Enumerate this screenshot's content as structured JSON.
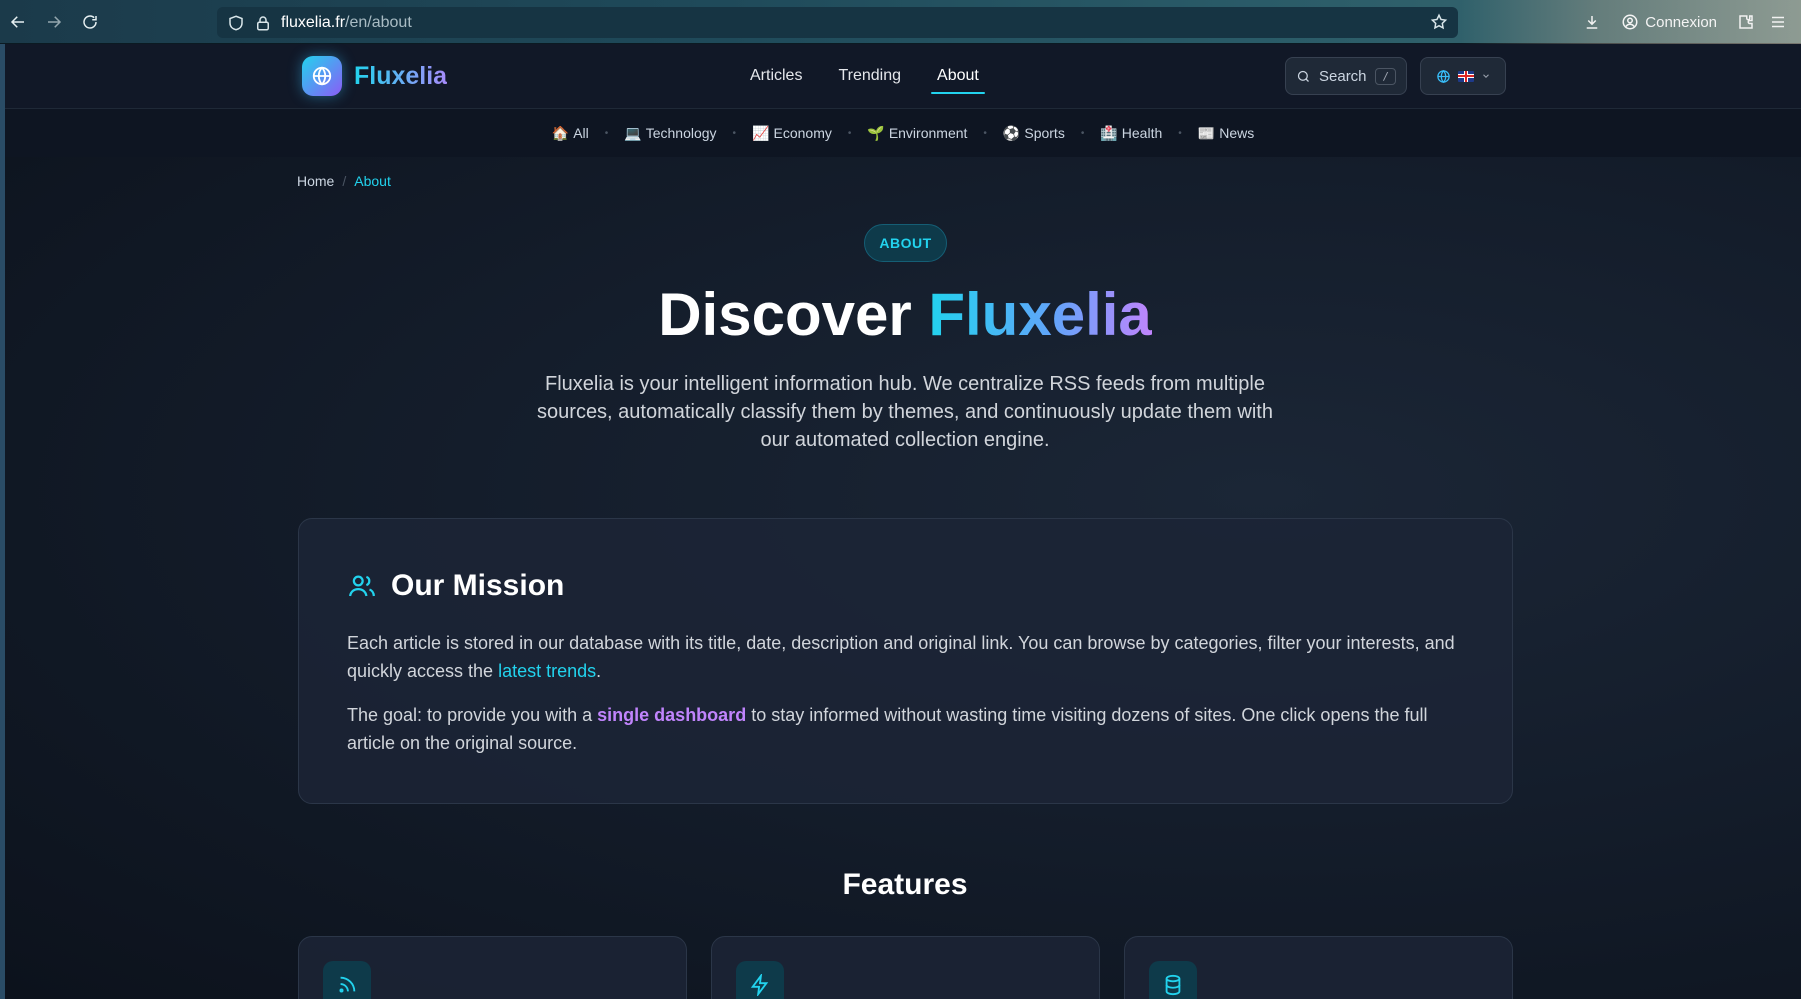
{
  "browser": {
    "url_host": "fluxelia.fr",
    "url_path": "/en/about",
    "account_label": "Connexion"
  },
  "header": {
    "brand": "Fluxelia",
    "nav": [
      "Articles",
      "Trending",
      "About"
    ],
    "active_nav": "About",
    "search_label": "Search",
    "search_shortcut": "/"
  },
  "categories": [
    {
      "emoji": "🏠",
      "label": "All"
    },
    {
      "emoji": "💻",
      "label": "Technology"
    },
    {
      "emoji": "📈",
      "label": "Economy"
    },
    {
      "emoji": "🌱",
      "label": "Environment"
    },
    {
      "emoji": "⚽",
      "label": "Sports"
    },
    {
      "emoji": "🏥",
      "label": "Health"
    },
    {
      "emoji": "📰",
      "label": "News"
    }
  ],
  "breadcrumb": {
    "home": "Home",
    "sep": "/",
    "current": "About"
  },
  "hero": {
    "pill": "ABOUT",
    "title_plain": "Discover ",
    "title_brand": "Fluxelia",
    "subtitle": "Fluxelia is your intelligent information hub. We centralize RSS feeds from multiple sources, automatically classify them by themes, and continuously update them with our automated collection engine."
  },
  "mission": {
    "title": "Our Mission",
    "p1_before": "Each article is stored in our database with its title, date, description and original link. You can browse by categories, filter your interests, and quickly access the ",
    "p1_link": "latest trends",
    "p1_after": ".",
    "p2_before": "The goal: to provide you with a ",
    "p2_highlight": "single dashboard",
    "p2_after": " to stay informed without wasting time visiting dozens of sites. One click opens the full article on the original source."
  },
  "features": {
    "title": "Features",
    "icons": [
      "rss-icon",
      "lightning-icon",
      "database-icon"
    ]
  },
  "colors": {
    "accent_cyan": "#22d3ee",
    "accent_purple": "#c084fc",
    "background": "#0f1623"
  }
}
